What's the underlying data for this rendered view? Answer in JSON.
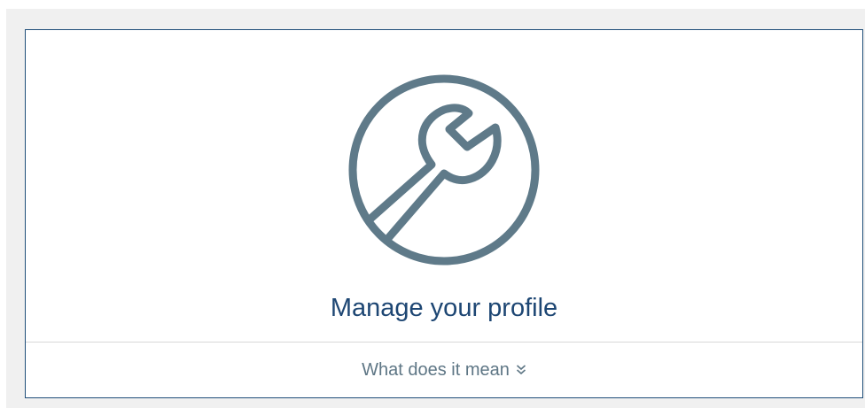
{
  "card": {
    "icon": "wrench-icon",
    "title": "Manage your profile",
    "toggle_label": "What does it mean",
    "toggle_icon": "double-chevron-down-icon"
  },
  "colors": {
    "border": "#1f4e79",
    "title": "#1d4673",
    "icon": "#5f7a89",
    "toggle_text": "#5e7685"
  }
}
